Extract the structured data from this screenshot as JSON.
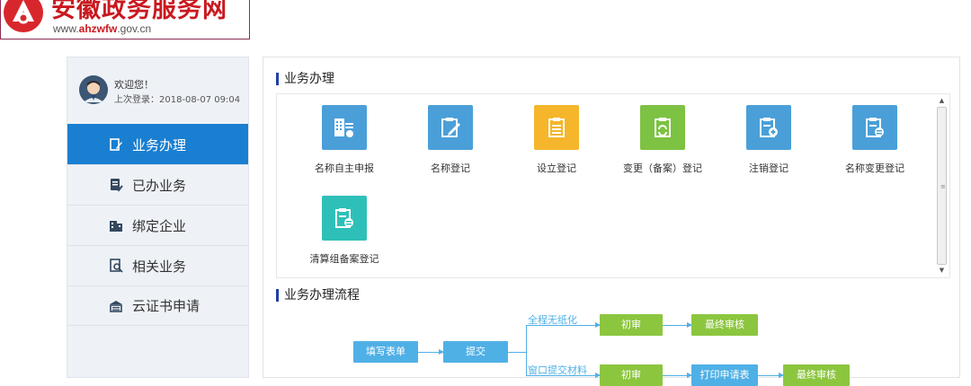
{
  "header": {
    "site_title": "安徽政务服务网",
    "site_url_prefix": "www.",
    "site_url_brand": "ahzwfw",
    "site_url_suffix": ".gov.cn",
    "brand_color": "#c9191f"
  },
  "user": {
    "welcome": "欢迎您！",
    "last_login": "上次登录：2018-08-07 09:04"
  },
  "sidebar": {
    "items": [
      {
        "label": "业务办理",
        "icon": "edit-document-icon",
        "active": true
      },
      {
        "label": "已办业务",
        "icon": "document-done-icon",
        "active": false
      },
      {
        "label": "绑定企业",
        "icon": "building-icon",
        "active": false
      },
      {
        "label": "相关业务",
        "icon": "document-search-icon",
        "active": false
      },
      {
        "label": "云证书申请",
        "icon": "certificate-icon",
        "active": false
      }
    ],
    "active_color": "#1a7fd1"
  },
  "business": {
    "title": "业务办理",
    "services": [
      {
        "label": "名称自主申报",
        "icon": "building-report-icon",
        "color": "#4a9fd8"
      },
      {
        "label": "名称登记",
        "icon": "clipboard-edit-icon",
        "color": "#4a9fd8"
      },
      {
        "label": "设立登记",
        "icon": "clipboard-list-icon",
        "color": "#f5b62b"
      },
      {
        "label": "变更（备案）登记",
        "icon": "clipboard-refresh-icon",
        "color": "#7dc242"
      },
      {
        "label": "注销登记",
        "icon": "clipboard-add-icon",
        "color": "#4a9fd8"
      },
      {
        "label": "名称变更登记",
        "icon": "clipboard-minus-icon",
        "color": "#4a9fd8"
      },
      {
        "label": "清算组备案登记",
        "icon": "clipboard-minus-icon",
        "color": "#2ec0b8"
      }
    ]
  },
  "flow": {
    "title": "业务办理流程",
    "fill_form": "填写表单",
    "submit": "提交",
    "branch_paperless": "全程无纸化",
    "branch_window": "窗口提交材料",
    "first_review": "初审",
    "final_review": "最终审核",
    "print_form": "打印申请表",
    "blue": "#4fb0e6",
    "green": "#8cc63f"
  }
}
